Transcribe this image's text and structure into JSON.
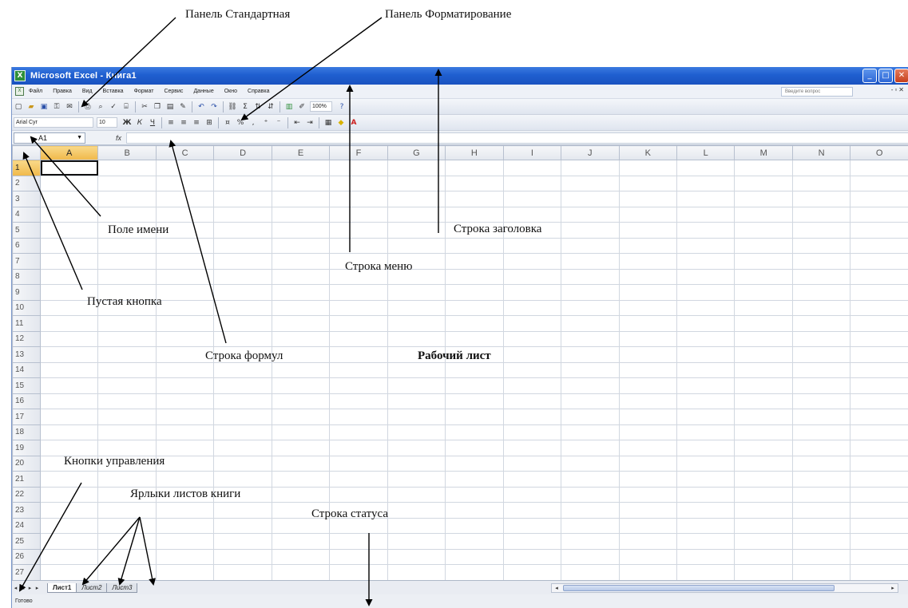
{
  "window": {
    "title": "Microsoft Excel - Книга1",
    "app_icon": "excel-icon",
    "controls": [
      "minimize",
      "maximize",
      "close"
    ]
  },
  "menu": {
    "items": [
      "Файл",
      "Правка",
      "Вид",
      "Вставка",
      "Формат",
      "Сервис",
      "Данные",
      "Окно",
      "Справка"
    ],
    "ask_placeholder": "Введите вопрос"
  },
  "toolbar_standard": {
    "zoom": "100%"
  },
  "toolbar_format": {
    "font_name": "Arial Cyr",
    "font_size": "10"
  },
  "formula_bar": {
    "name_box": "A1",
    "fx": "fx"
  },
  "grid": {
    "columns": [
      "A",
      "B",
      "C",
      "D",
      "E",
      "F",
      "G",
      "H",
      "I",
      "J",
      "K",
      "L",
      "M",
      "N",
      "O"
    ],
    "rows": [
      "1",
      "2",
      "3",
      "4",
      "5",
      "6",
      "7",
      "8",
      "9",
      "10",
      "11",
      "12",
      "13",
      "14",
      "15",
      "16",
      "17",
      "18",
      "19",
      "20",
      "21",
      "22",
      "23",
      "24",
      "25",
      "26",
      "27"
    ],
    "active_cell": "A1"
  },
  "sheets": {
    "tabs": [
      "Лист1",
      "Лист2",
      "Лист3"
    ],
    "active": "Лист1"
  },
  "status": {
    "text": "Готово"
  },
  "annotations": {
    "standard_panel": "Панель Стандартная",
    "format_panel": "Панель Форматирование",
    "name_field": "Поле имени",
    "title_row": "Строка заголовка",
    "menu_row": "Строка меню",
    "empty_button": "Пустая кнопка",
    "formula_row": "Строка формул",
    "worksheet": "Рабочий лист",
    "control_buttons": "Кнопки управления",
    "sheet_tabs": "Ярлыки листов книги",
    "status_row": "Строка статуса"
  }
}
